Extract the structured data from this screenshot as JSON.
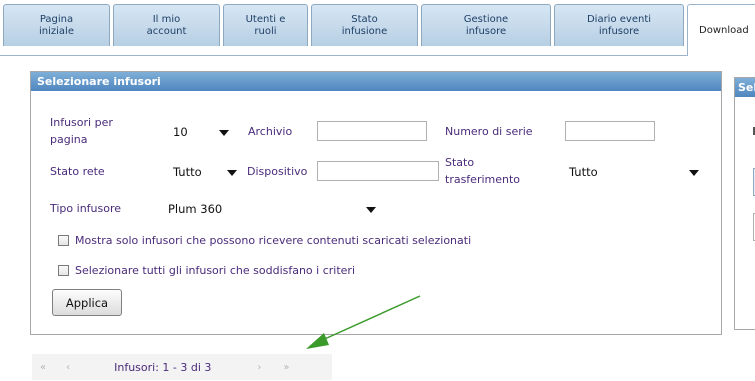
{
  "tabs": [
    {
      "label": "Pagina\niniziale"
    },
    {
      "label": "Il mio\naccount"
    },
    {
      "label": "Utenti e\nruoli"
    },
    {
      "label": "Stato\ninfusione"
    },
    {
      "label": "Gestione\ninfusore"
    },
    {
      "label": "Diario eventi\ninfusore"
    },
    {
      "label": "Download",
      "active": true
    }
  ],
  "panel": {
    "title": "Selezionare infusori",
    "per_page_label": "Infusori per\npagina",
    "per_page_value": "10",
    "archive_label": "Archivio",
    "archive_value": "",
    "serial_label": "Numero di serie",
    "serial_value": "",
    "net_status_label": "Stato rete",
    "net_status_value": "Tutto",
    "device_label": "Dispositivo",
    "device_value": "",
    "transfer_status_label": "Stato\ntrasferimento",
    "transfer_status_value": "Tutto",
    "type_label": "Tipo infusore",
    "type_value": "Plum 360",
    "checkbox_1": "Mostra solo infusori che possono ricevere contenuti scaricati selezionati",
    "checkbox_2": "Selezionare tutti gli infusori che soddisfano i criteri",
    "apply_label": "Applica"
  },
  "right_panel": {
    "title_partial": "Sele"
  },
  "pager": {
    "first": "«",
    "prev": "‹",
    "info": "Infusori: 1 - 3 di 3",
    "next": "›",
    "last": "»"
  },
  "colors": {
    "accent": "#4f86bf",
    "label": "#4a2b7a",
    "annotation_arrow": "#3a9a2a"
  },
  "icons": {
    "dropdown": "triangle-down",
    "arrow": "green-annotation-arrow"
  }
}
